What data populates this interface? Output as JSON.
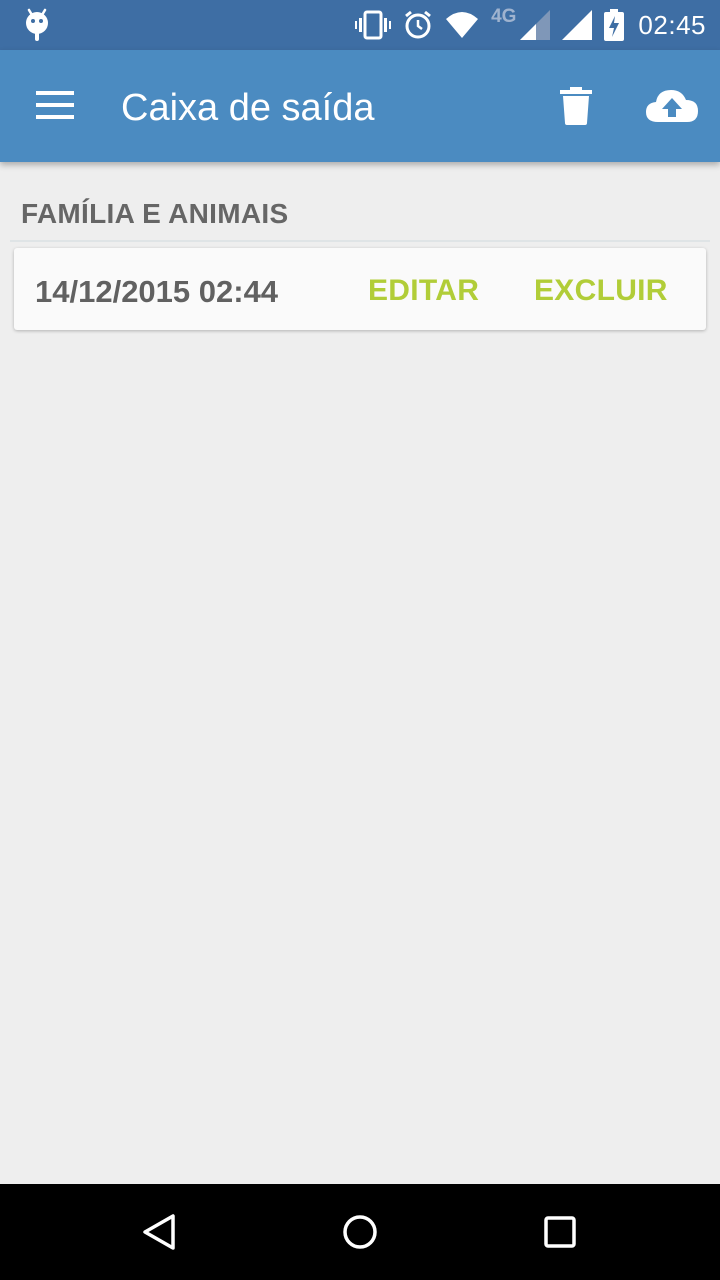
{
  "status_bar": {
    "time": "02:45",
    "network_label": "4G",
    "icons": [
      "android-icon",
      "vibrate-icon",
      "alarm-icon",
      "wifi-icon",
      "signal-icon",
      "signal-full-icon",
      "battery-charging-icon"
    ]
  },
  "app_bar": {
    "title": "Caixa de saída",
    "icons": [
      "menu-icon",
      "trash-icon",
      "cloud-upload-icon"
    ],
    "color": "#4b8bc1"
  },
  "list": {
    "section_title": "FAMÍLIA E ANIMAIS",
    "items": [
      {
        "date": "14/12/2015 02:44",
        "edit_label": "EDITAR",
        "delete_label": "EXCLUIR"
      }
    ],
    "accent_color": "#b1cd38"
  },
  "nav_bar": {
    "icons": [
      "back-icon",
      "home-icon",
      "recents-icon"
    ]
  }
}
